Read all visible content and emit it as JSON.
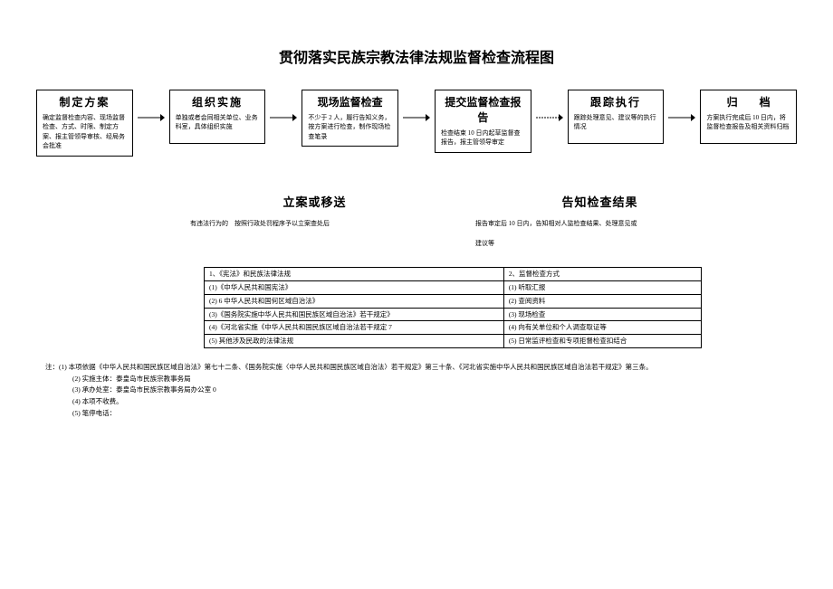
{
  "title": "贯彻落实民族宗教法律法规监督检查流程图",
  "flow": [
    {
      "title": "制定方案",
      "title_class": "",
      "body": "确定监督检查内容、现场监督检查、方式、时限、制定方案、报主管领导审核、经局务会批准"
    },
    {
      "title": "组织实施",
      "title_class": "",
      "body": "单独或者会同相关单位、业务科室，具体组织实施"
    },
    {
      "title": "现场监督检查",
      "title_class": "nowspace",
      "body": "不少于 2 人，履行告知义务，按方案进行检查，制作现场检查笔录"
    },
    {
      "title": "提交监督检查报告",
      "title_class": "nowspace",
      "body": "检查结束 10 日内起草监督查报告，报主管领导审定"
    },
    {
      "title": "跟踪执行",
      "title_class": "",
      "body": "跟踪处理意见、建议等的执行情况"
    },
    {
      "title": "归　　档",
      "title_class": "nowspace",
      "body": "方案执行完成后 10 日内，将监督检查报告及相关资料归档"
    }
  ],
  "sub_left": {
    "title": "立案或移送",
    "body": "有违法行为的　按照行政处罚程序予以立案查处后"
  },
  "sub_right": {
    "title": "告知检查结果",
    "body": "报告审定后 10 日内，告知相对人监检查结果、处理意见或\n\n建议等"
  },
  "table": [
    [
      "1、《宪法》和民族法律法规",
      "2、监督检查方式"
    ],
    [
      "(1)《中华人民共和国宪法》",
      "(1) 听取汇报"
    ],
    [
      "(2) 6 中华人民共和国何区域自治法》",
      "(2) 查阅资料"
    ],
    [
      "(3)《国务院实施中华人民共和国民族区域自治法》若干规定》",
      "(3) 现场检查"
    ],
    [
      "(4)《河北省实施《中华人民共和国民族区域自治法若干规定 7",
      "(4) 向有关单位和个人调查取证等"
    ],
    [
      "(5) 其他涉及民政的法律法规",
      "(5) 日常监评检查和专项拒督检查扣结合"
    ]
  ],
  "notes": {
    "head": "注：",
    "l1": "(1) 本项依据《中华人民共和国民族区域自治法》第七十二条、《国务院实施〈中华人民共和国民族区域自治法〉若干规定》第三十条、《河北省实施中华人民共和国民族区域自治法若干规定》第三条。",
    "l2": "(2) 实施主体：泰皇岛市民族宗教事务局",
    "l3": "(3) 承办处室：泰皇岛市民族宗教事务局办公室 0",
    "l4": "(4) 本项不收费。",
    "l5": "(5) 笔停电话："
  }
}
